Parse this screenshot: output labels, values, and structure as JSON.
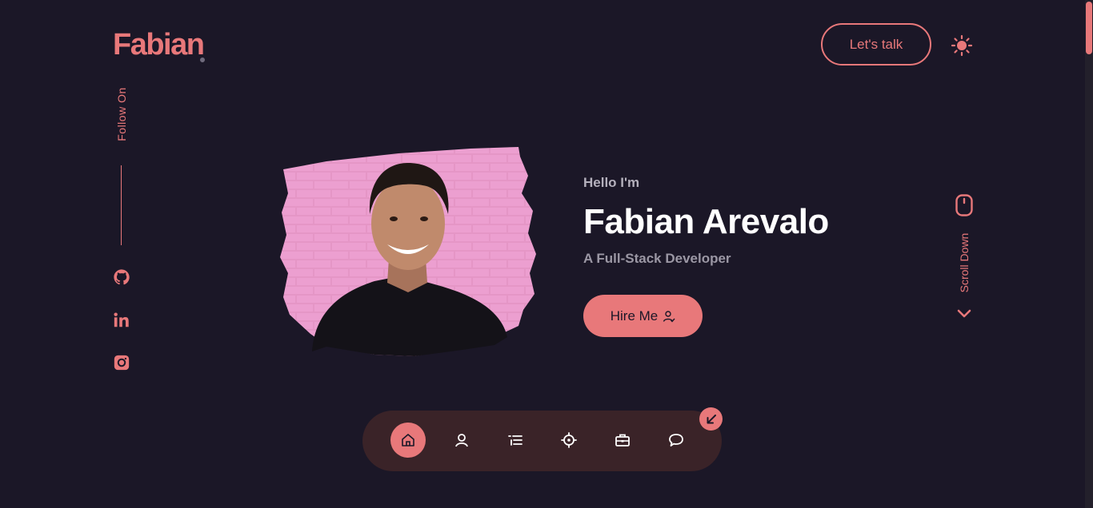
{
  "header": {
    "logo": "Fabian",
    "lets_talk_label": "Let's talk",
    "theme_icon": "sun-icon"
  },
  "sidebar": {
    "follow_label": "Follow On",
    "socials": [
      {
        "name": "github",
        "icon": "github-icon"
      },
      {
        "name": "linkedin",
        "icon": "linkedin-icon"
      },
      {
        "name": "instagram",
        "icon": "instagram-icon"
      }
    ]
  },
  "hero": {
    "greeting": "Hello I'm",
    "name": "Fabian Arevalo",
    "role": "A Full-Stack Developer",
    "hire_label": "Hire Me",
    "hire_icon": "user-icon",
    "photo": "profile-photo"
  },
  "scroll": {
    "label": "Scroll Down",
    "icon": "mouse-icon"
  },
  "dock": {
    "items": [
      {
        "name": "home",
        "icon": "home-icon",
        "active": true
      },
      {
        "name": "about",
        "icon": "user-icon",
        "active": false
      },
      {
        "name": "skills",
        "icon": "list-icon",
        "active": false
      },
      {
        "name": "services",
        "icon": "target-icon",
        "active": false
      },
      {
        "name": "portfolio",
        "icon": "briefcase-icon",
        "active": false
      },
      {
        "name": "contact",
        "icon": "message-icon",
        "active": false
      }
    ],
    "collapse_icon": "arrow-down-left-icon"
  },
  "colors": {
    "background": "#1b1727",
    "accent": "#e8787a",
    "dock": "#3a2328",
    "muted_text": "#b4b0bc"
  }
}
